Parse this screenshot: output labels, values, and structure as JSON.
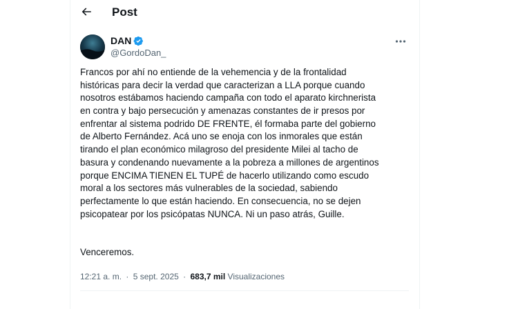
{
  "header": {
    "title": "Post"
  },
  "author": {
    "name": "DAN",
    "handle": "@GordoDan_",
    "verified": true
  },
  "tweet": {
    "lines": [
      "Francos por ahí no entiende de la vehemencia y de la frontalidad",
      "históricas para decir la verdad que caracterizan a LLA porque cuando",
      "nosotros estábamos haciendo campaña con todo el aparato kirchnerista",
      "en contra y bajo persecución y amenazas constantes de ir presos por",
      "enfrentar al sistema podrido DE FRENTE, él formaba parte del gobierno",
      "de Alberto Fernández. Acá uno se enoja con los inmorales que están",
      "tirando el plan económico milagroso del presidente Milei al tacho de",
      "basura y condenando nuevamente a la pobreza a millones de argentinos",
      "porque ENCIMA TIENEN EL TUPÉ de hacerlo utilizando como escudo",
      "moral a los sectores más vulnerables de la sociedad, sabiendo",
      "perfectamente lo que están haciendo. En consecuencia, no se dejen",
      "psicopatear por los psicópatas NUNCA. Ni un paso atrás, Guille."
    ],
    "signoff": "Venceremos."
  },
  "meta": {
    "time": "12:21 a. m.",
    "separator": "·",
    "date": "5 sept. 2025",
    "views_count": "683,7 mil",
    "views_label": "Visualizaciones"
  },
  "icons": {
    "back": "arrow-left-icon",
    "verified": "verified-badge-icon",
    "more": "more-horizontal-icon"
  },
  "colors": {
    "verified": "#1d9bf0",
    "secondary_text": "#536471",
    "border": "#eff3f4"
  }
}
